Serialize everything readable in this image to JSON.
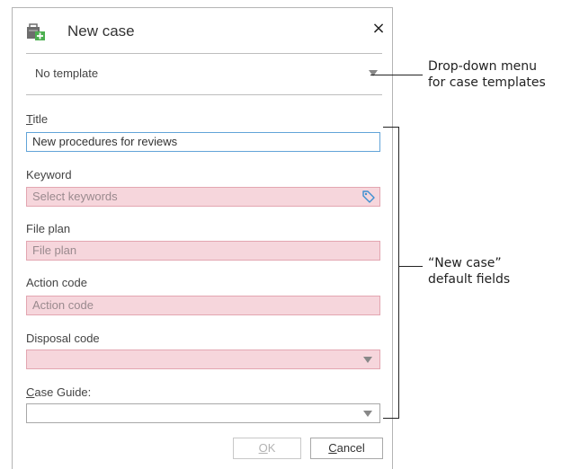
{
  "dialog": {
    "title": "New case",
    "close_glyph": "×",
    "icon": "case-folder-icon",
    "template": {
      "value": "No template",
      "icon": "chevron-down-icon"
    },
    "fields": {
      "title": {
        "label_underlined": "T",
        "label_rest": "itle",
        "value": "New procedures for reviews"
      },
      "keyword": {
        "label": "Keyword",
        "placeholder": "Select keywords",
        "icon": "tag-icon"
      },
      "file_plan": {
        "label": "File plan",
        "placeholder": "File plan"
      },
      "action_code": {
        "label": "Action code",
        "placeholder": "Action code"
      },
      "disposal_code": {
        "label": "Disposal code",
        "value": ""
      },
      "case_guide": {
        "label_underlined": "C",
        "label_rest": "ase Guide:",
        "value": ""
      }
    },
    "buttons": {
      "ok_underlined": "O",
      "ok_rest": "K",
      "ok_enabled": false,
      "cancel_underlined": "C",
      "cancel_rest": "ancel"
    }
  },
  "annotations": {
    "dropdown": {
      "line1": "Drop-down menu",
      "line2": "for case templates"
    },
    "fields": {
      "line1": "“New case”",
      "line2": "default fields"
    }
  },
  "colors": {
    "required_fill": "#f6d6dc",
    "required_border": "#e3a6b1",
    "focus_border": "#62a4d8"
  }
}
